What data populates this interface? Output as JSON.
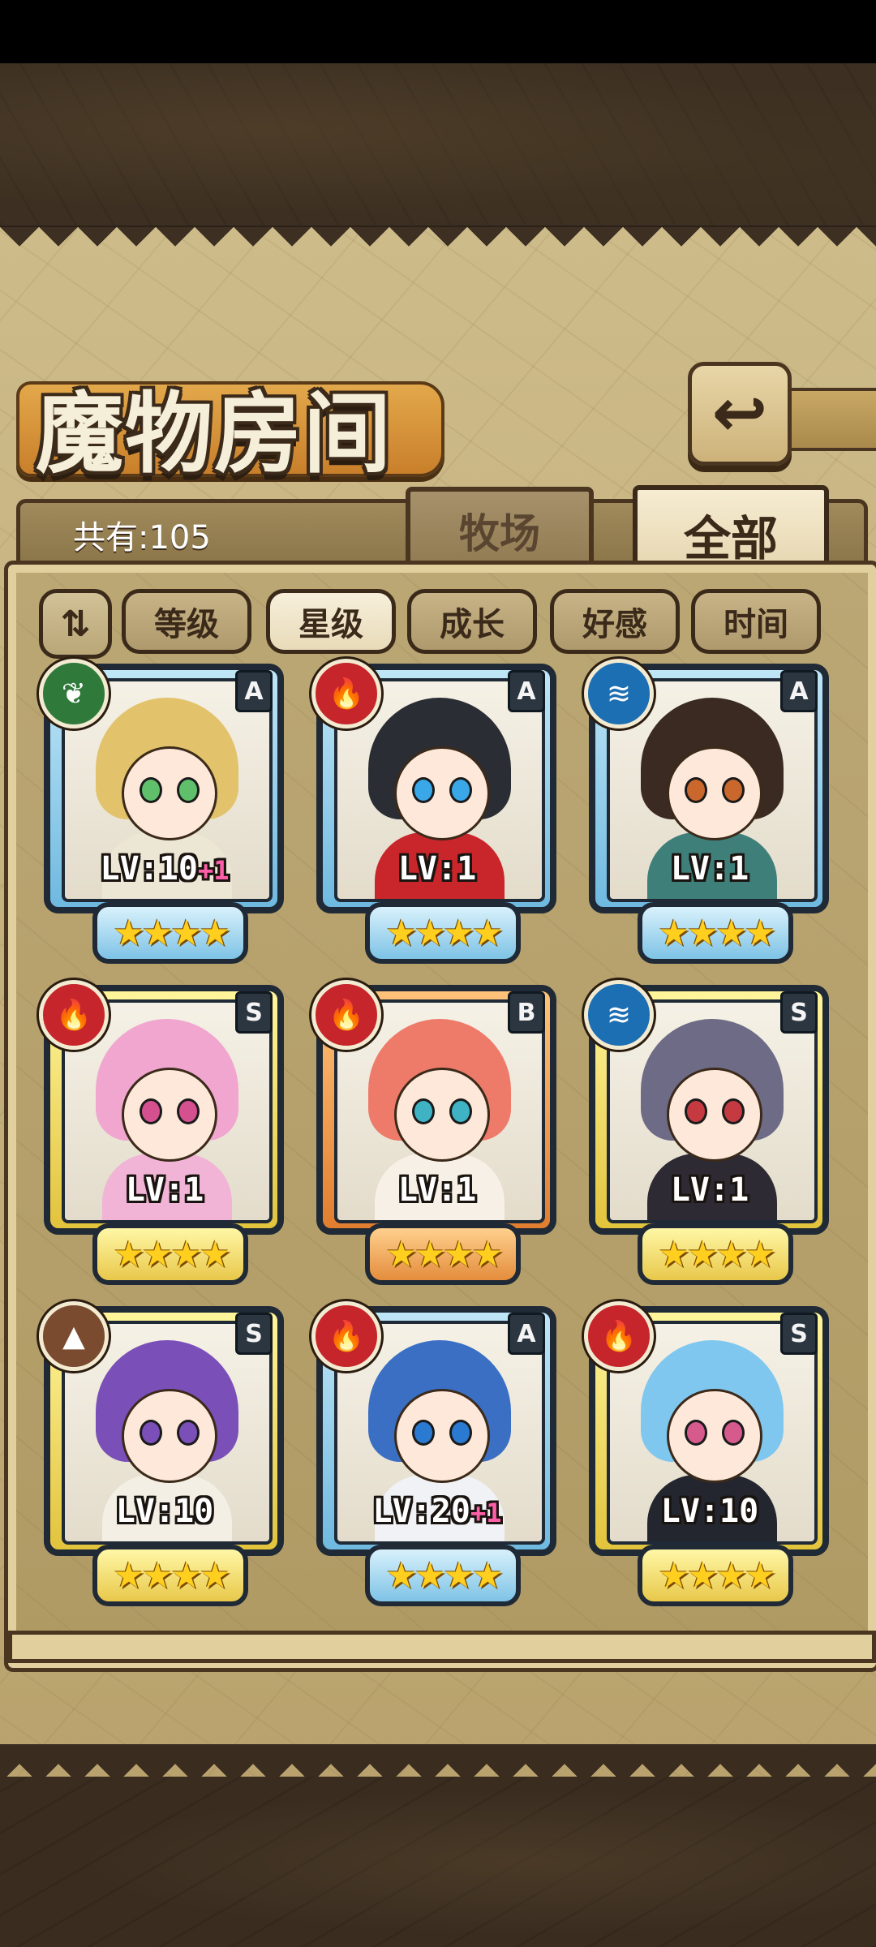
{
  "header": {
    "title": "魔物房间",
    "back_icon": "↩"
  },
  "tabs": {
    "count_label": "共有:105",
    "farm_label": "牧场",
    "all_label": "全部"
  },
  "sort": {
    "toggle_label": "⇅",
    "buttons": [
      "等级",
      "星级",
      "成长",
      "好感",
      "时间"
    ],
    "active": "星级"
  },
  "monsters": [
    {
      "level": "LV:10",
      "plus": "+1",
      "rank": "A",
      "element": "grass",
      "element_icon": "❦",
      "frame": "blue",
      "stars": "★★★★",
      "hair_color": "#e2c26a",
      "body_color": "#ece6d4",
      "eye_color": "#5fbf6a"
    },
    {
      "level": "LV:1",
      "plus": "",
      "rank": "A",
      "element": "fire",
      "element_icon": "🔥",
      "frame": "blue",
      "stars": "★★★★",
      "hair_color": "#2a2d33",
      "body_color": "#c8262b",
      "eye_color": "#3aa7e8"
    },
    {
      "level": "LV:1",
      "plus": "",
      "rank": "A",
      "element": "water",
      "element_icon": "≋",
      "frame": "blue",
      "stars": "★★★★",
      "hair_color": "#3a2a22",
      "body_color": "#3f7f7a",
      "eye_color": "#c9672c"
    },
    {
      "level": "LV:1",
      "plus": "",
      "rank": "S",
      "element": "fire",
      "element_icon": "🔥",
      "frame": "gold",
      "stars": "★★★★",
      "hair_color": "#f0a6cf",
      "body_color": "#f1b3d6",
      "eye_color": "#d4508f"
    },
    {
      "level": "LV:1",
      "plus": "",
      "rank": "B",
      "element": "fire",
      "element_icon": "🔥",
      "frame": "orange",
      "stars": "★★★★",
      "hair_color": "#ee7a6a",
      "body_color": "#f6f0e6",
      "eye_color": "#3fb3c4"
    },
    {
      "level": "LV:1",
      "plus": "",
      "rank": "S",
      "element": "water",
      "element_icon": "≋",
      "frame": "gold",
      "stars": "★★★★",
      "hair_color": "#6e6b86",
      "body_color": "#2d2a33",
      "eye_color": "#c53a40"
    },
    {
      "level": "LV:10",
      "plus": "",
      "rank": "S",
      "element": "earth",
      "element_icon": "▲",
      "frame": "gold",
      "stars": "★★★★",
      "hair_color": "#7a4fb8",
      "body_color": "#f3efe4",
      "eye_color": "#7a4fb8"
    },
    {
      "level": "LV:20",
      "plus": "+1",
      "rank": "A",
      "element": "fire",
      "element_icon": "🔥",
      "frame": "blue",
      "stars": "★★★★",
      "hair_color": "#3a6fc4",
      "body_color": "#f1f2f6",
      "eye_color": "#2b7ad1"
    },
    {
      "level": "LV:10",
      "plus": "",
      "rank": "S",
      "element": "fire",
      "element_icon": "🔥",
      "frame": "gold",
      "stars": "★★★★",
      "hair_color": "#7fc7ef",
      "body_color": "#23262e",
      "eye_color": "#d65a8c"
    }
  ]
}
